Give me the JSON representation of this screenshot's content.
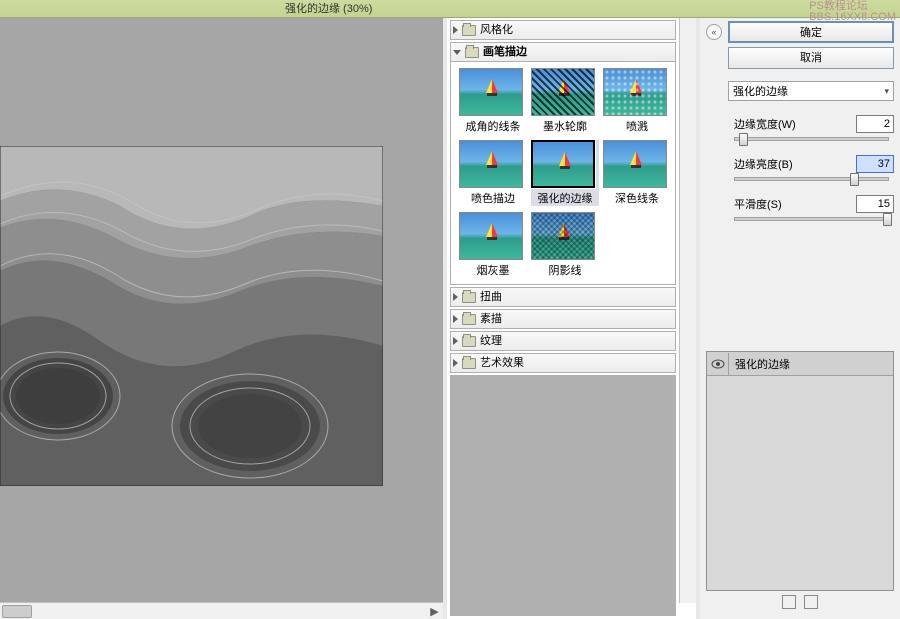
{
  "watermark": {
    "l1": "PS教程论坛",
    "l2": "BBS.16XX8.COM"
  },
  "title": "强化的边缘 (30%)",
  "categories": {
    "stylize": "风格化",
    "brush_strokes": "画笔描边",
    "distort": "扭曲",
    "sketch": "素描",
    "texture": "纹理",
    "artistic": "艺术效果"
  },
  "thumbs": [
    {
      "label": "成角的线条"
    },
    {
      "label": "墨水轮廓"
    },
    {
      "label": "喷溅"
    },
    {
      "label": "喷色描边"
    },
    {
      "label": "强化的边缘"
    },
    {
      "label": "深色线条"
    },
    {
      "label": "烟灰墨"
    },
    {
      "label": "阴影线"
    }
  ],
  "buttons": {
    "ok": "确定",
    "cancel": "取消"
  },
  "filter_dropdown": "强化的边缘",
  "sliders": {
    "edge_width": {
      "label": "边缘宽度(W)",
      "value": "2",
      "pos": 4
    },
    "edge_brightness": {
      "label": "边缘亮度(B)",
      "value": "37",
      "pos": 115,
      "selected": true
    },
    "smoothness": {
      "label": "平滑度(S)",
      "value": "15",
      "pos": 148
    }
  },
  "layer_name": "强化的边缘"
}
